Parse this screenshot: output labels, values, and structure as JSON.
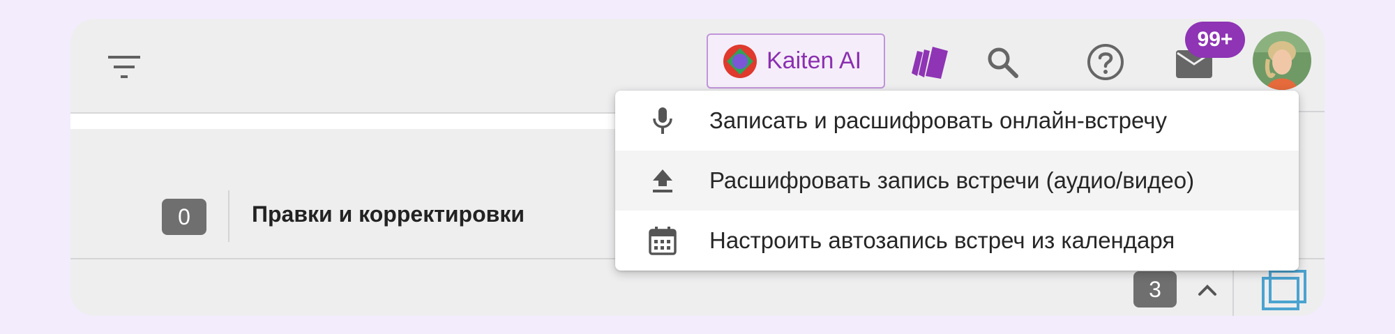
{
  "toolbar": {
    "ai_button_label": "Kaiten AI",
    "notifications_count": "99+"
  },
  "column": {
    "card_count": "0",
    "title": "Правки и корректировки"
  },
  "footer": {
    "count": "3"
  },
  "ai_menu": {
    "items": [
      {
        "label": "Записать и расшифровать онлайн-встречу",
        "icon": "microphone-icon"
      },
      {
        "label": "Расшифровать запись встречи (аудио/видео)",
        "icon": "upload-icon"
      },
      {
        "label": "Настроить автозапись встреч из календаря",
        "icon": "calendar-icon"
      }
    ]
  },
  "colors": {
    "accent": "#8e34b4",
    "background": "#f3ecfd",
    "surface": "#eeeeef"
  }
}
